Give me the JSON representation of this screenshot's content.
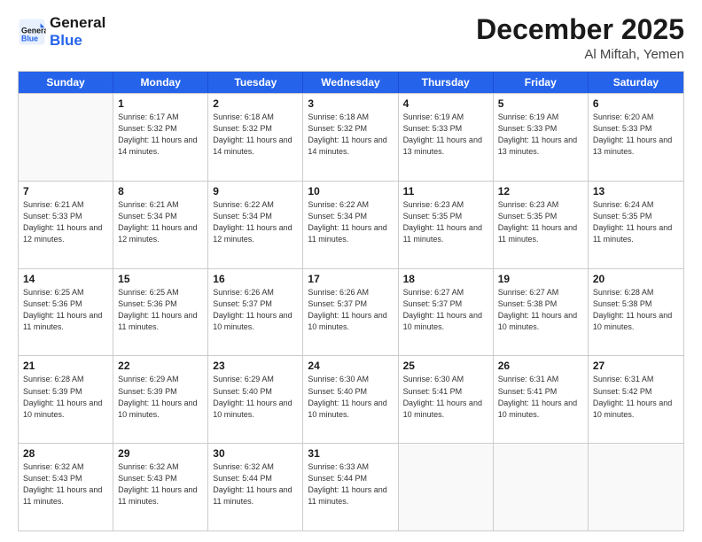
{
  "header": {
    "logo_general": "General",
    "logo_blue": "Blue",
    "month_title": "December 2025",
    "location": "Al Miftah, Yemen"
  },
  "days_of_week": [
    "Sunday",
    "Monday",
    "Tuesday",
    "Wednesday",
    "Thursday",
    "Friday",
    "Saturday"
  ],
  "weeks": [
    [
      {
        "day": "",
        "sunrise": "",
        "sunset": "",
        "daylight": ""
      },
      {
        "day": "1",
        "sunrise": "Sunrise: 6:17 AM",
        "sunset": "Sunset: 5:32 PM",
        "daylight": "Daylight: 11 hours and 14 minutes."
      },
      {
        "day": "2",
        "sunrise": "Sunrise: 6:18 AM",
        "sunset": "Sunset: 5:32 PM",
        "daylight": "Daylight: 11 hours and 14 minutes."
      },
      {
        "day": "3",
        "sunrise": "Sunrise: 6:18 AM",
        "sunset": "Sunset: 5:32 PM",
        "daylight": "Daylight: 11 hours and 14 minutes."
      },
      {
        "day": "4",
        "sunrise": "Sunrise: 6:19 AM",
        "sunset": "Sunset: 5:33 PM",
        "daylight": "Daylight: 11 hours and 13 minutes."
      },
      {
        "day": "5",
        "sunrise": "Sunrise: 6:19 AM",
        "sunset": "Sunset: 5:33 PM",
        "daylight": "Daylight: 11 hours and 13 minutes."
      },
      {
        "day": "6",
        "sunrise": "Sunrise: 6:20 AM",
        "sunset": "Sunset: 5:33 PM",
        "daylight": "Daylight: 11 hours and 13 minutes."
      }
    ],
    [
      {
        "day": "7",
        "sunrise": "Sunrise: 6:21 AM",
        "sunset": "Sunset: 5:33 PM",
        "daylight": "Daylight: 11 hours and 12 minutes."
      },
      {
        "day": "8",
        "sunrise": "Sunrise: 6:21 AM",
        "sunset": "Sunset: 5:34 PM",
        "daylight": "Daylight: 11 hours and 12 minutes."
      },
      {
        "day": "9",
        "sunrise": "Sunrise: 6:22 AM",
        "sunset": "Sunset: 5:34 PM",
        "daylight": "Daylight: 11 hours and 12 minutes."
      },
      {
        "day": "10",
        "sunrise": "Sunrise: 6:22 AM",
        "sunset": "Sunset: 5:34 PM",
        "daylight": "Daylight: 11 hours and 11 minutes."
      },
      {
        "day": "11",
        "sunrise": "Sunrise: 6:23 AM",
        "sunset": "Sunset: 5:35 PM",
        "daylight": "Daylight: 11 hours and 11 minutes."
      },
      {
        "day": "12",
        "sunrise": "Sunrise: 6:23 AM",
        "sunset": "Sunset: 5:35 PM",
        "daylight": "Daylight: 11 hours and 11 minutes."
      },
      {
        "day": "13",
        "sunrise": "Sunrise: 6:24 AM",
        "sunset": "Sunset: 5:35 PM",
        "daylight": "Daylight: 11 hours and 11 minutes."
      }
    ],
    [
      {
        "day": "14",
        "sunrise": "Sunrise: 6:25 AM",
        "sunset": "Sunset: 5:36 PM",
        "daylight": "Daylight: 11 hours and 11 minutes."
      },
      {
        "day": "15",
        "sunrise": "Sunrise: 6:25 AM",
        "sunset": "Sunset: 5:36 PM",
        "daylight": "Daylight: 11 hours and 11 minutes."
      },
      {
        "day": "16",
        "sunrise": "Sunrise: 6:26 AM",
        "sunset": "Sunset: 5:37 PM",
        "daylight": "Daylight: 11 hours and 10 minutes."
      },
      {
        "day": "17",
        "sunrise": "Sunrise: 6:26 AM",
        "sunset": "Sunset: 5:37 PM",
        "daylight": "Daylight: 11 hours and 10 minutes."
      },
      {
        "day": "18",
        "sunrise": "Sunrise: 6:27 AM",
        "sunset": "Sunset: 5:37 PM",
        "daylight": "Daylight: 11 hours and 10 minutes."
      },
      {
        "day": "19",
        "sunrise": "Sunrise: 6:27 AM",
        "sunset": "Sunset: 5:38 PM",
        "daylight": "Daylight: 11 hours and 10 minutes."
      },
      {
        "day": "20",
        "sunrise": "Sunrise: 6:28 AM",
        "sunset": "Sunset: 5:38 PM",
        "daylight": "Daylight: 11 hours and 10 minutes."
      }
    ],
    [
      {
        "day": "21",
        "sunrise": "Sunrise: 6:28 AM",
        "sunset": "Sunset: 5:39 PM",
        "daylight": "Daylight: 11 hours and 10 minutes."
      },
      {
        "day": "22",
        "sunrise": "Sunrise: 6:29 AM",
        "sunset": "Sunset: 5:39 PM",
        "daylight": "Daylight: 11 hours and 10 minutes."
      },
      {
        "day": "23",
        "sunrise": "Sunrise: 6:29 AM",
        "sunset": "Sunset: 5:40 PM",
        "daylight": "Daylight: 11 hours and 10 minutes."
      },
      {
        "day": "24",
        "sunrise": "Sunrise: 6:30 AM",
        "sunset": "Sunset: 5:40 PM",
        "daylight": "Daylight: 11 hours and 10 minutes."
      },
      {
        "day": "25",
        "sunrise": "Sunrise: 6:30 AM",
        "sunset": "Sunset: 5:41 PM",
        "daylight": "Daylight: 11 hours and 10 minutes."
      },
      {
        "day": "26",
        "sunrise": "Sunrise: 6:31 AM",
        "sunset": "Sunset: 5:41 PM",
        "daylight": "Daylight: 11 hours and 10 minutes."
      },
      {
        "day": "27",
        "sunrise": "Sunrise: 6:31 AM",
        "sunset": "Sunset: 5:42 PM",
        "daylight": "Daylight: 11 hours and 10 minutes."
      }
    ],
    [
      {
        "day": "28",
        "sunrise": "Sunrise: 6:32 AM",
        "sunset": "Sunset: 5:43 PM",
        "daylight": "Daylight: 11 hours and 11 minutes."
      },
      {
        "day": "29",
        "sunrise": "Sunrise: 6:32 AM",
        "sunset": "Sunset: 5:43 PM",
        "daylight": "Daylight: 11 hours and 11 minutes."
      },
      {
        "day": "30",
        "sunrise": "Sunrise: 6:32 AM",
        "sunset": "Sunset: 5:44 PM",
        "daylight": "Daylight: 11 hours and 11 minutes."
      },
      {
        "day": "31",
        "sunrise": "Sunrise: 6:33 AM",
        "sunset": "Sunset: 5:44 PM",
        "daylight": "Daylight: 11 hours and 11 minutes."
      },
      {
        "day": "",
        "sunrise": "",
        "sunset": "",
        "daylight": ""
      },
      {
        "day": "",
        "sunrise": "",
        "sunset": "",
        "daylight": ""
      },
      {
        "day": "",
        "sunrise": "",
        "sunset": "",
        "daylight": ""
      }
    ]
  ]
}
